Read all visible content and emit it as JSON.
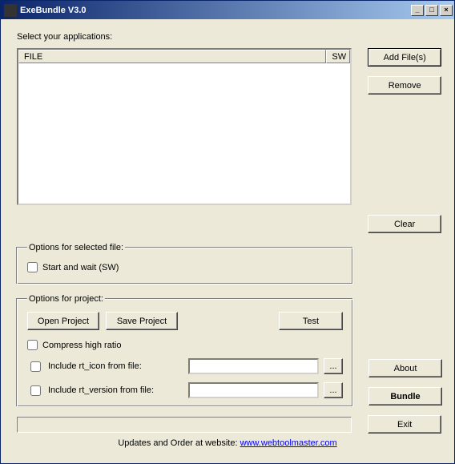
{
  "window": {
    "title": "ExeBundle V3.0"
  },
  "main": {
    "select_label": "Select your applications:",
    "columns": {
      "file": "FILE",
      "sw": "SW"
    },
    "buttons": {
      "add": "Add File(s)",
      "remove": "Remove",
      "clear": "Clear"
    }
  },
  "options_file": {
    "legend": "Options for selected file:",
    "start_wait": "Start and wait (SW)"
  },
  "options_project": {
    "legend": "Options for project:",
    "open": "Open Project",
    "save": "Save Project",
    "test": "Test",
    "compress": "Compress high ratio",
    "include_icon": "Include rt_icon from file:",
    "include_version": "Include rt_version from file:",
    "browse": "..."
  },
  "right": {
    "about": "About",
    "bundle": "Bundle",
    "exit": "Exit"
  },
  "footer": {
    "prefix": "Updates and Order at website: ",
    "link": "www.webtoolmaster.com"
  },
  "values": {
    "icon_path": "",
    "version_path": ""
  }
}
